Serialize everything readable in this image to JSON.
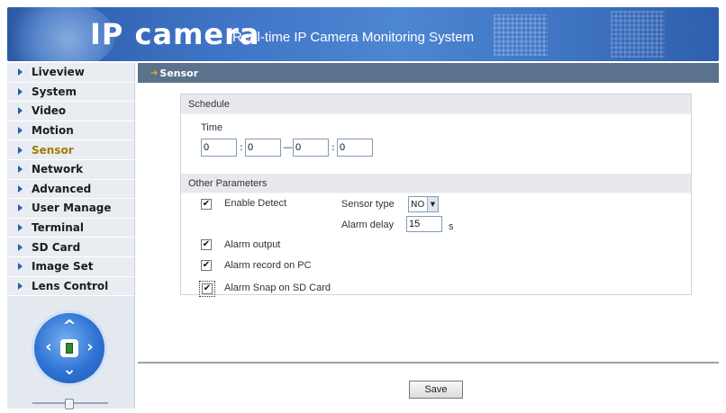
{
  "header": {
    "logo_text": "IP camera",
    "tagline": "Real-time IP Camera Monitoring System"
  },
  "sidebar": {
    "items": [
      {
        "label": "Liveview"
      },
      {
        "label": "System"
      },
      {
        "label": "Video"
      },
      {
        "label": "Motion"
      },
      {
        "label": "Sensor"
      },
      {
        "label": "Network"
      },
      {
        "label": "Advanced"
      },
      {
        "label": "User Manage"
      },
      {
        "label": "Terminal"
      },
      {
        "label": "SD Card"
      },
      {
        "label": "Image Set"
      },
      {
        "label": "Lens Control"
      }
    ],
    "active_index": 4
  },
  "page_title": "Sensor",
  "schedule": {
    "header": "Schedule",
    "time_label": "Time",
    "start_hour": "0",
    "start_minute": "0",
    "end_hour": "0",
    "end_minute": "0",
    "colon": ":",
    "range_sep": "—"
  },
  "other_parameters": {
    "header": "Other Parameters",
    "enable_detect": {
      "label": "Enable Detect",
      "checked": true
    },
    "sensor_type": {
      "label": "Sensor type",
      "value": "NO"
    },
    "alarm_delay": {
      "label": "Alarm delay",
      "value": "15",
      "unit": "s"
    },
    "alarm_output": {
      "label": "Alarm output",
      "checked": true
    },
    "alarm_record": {
      "label": "Alarm record on PC",
      "checked": true
    },
    "alarm_snap": {
      "label": "Alarm Snap on SD Card",
      "checked": true
    }
  },
  "check_mark": "✔",
  "icons": {
    "ptz_up": "^",
    "ptz_down": "⌄",
    "ptz_left": "‹",
    "ptz_right": "›",
    "dropdown": "▼"
  },
  "save_label": "Save",
  "colors": {
    "title_bar": "#5a728c",
    "header_blue": "#3f74c6",
    "active_nav": "#a37b00"
  }
}
